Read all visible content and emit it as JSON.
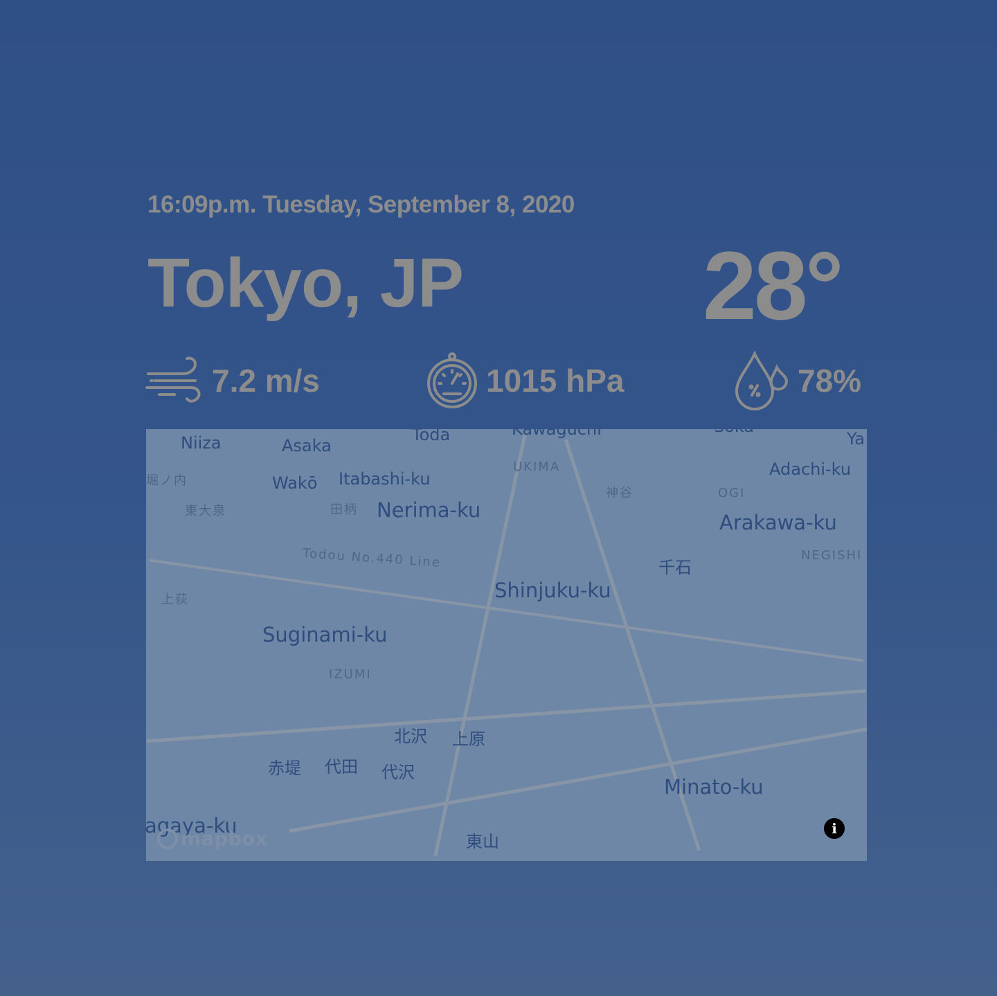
{
  "header": {
    "datetime": "16:09p.m. Tuesday, September 8, 2020",
    "city": "Tokyo, JP",
    "temperature": "28°"
  },
  "stats": {
    "wind": {
      "icon": "wind-icon",
      "value": "7.2 m/s"
    },
    "pressure": {
      "icon": "barometer-icon",
      "value": "1015 hPa"
    },
    "humidity": {
      "icon": "humidity-drops-icon",
      "value": "78%"
    }
  },
  "map": {
    "labels": [
      "Niiza",
      "Asaka",
      "Toda",
      "Kawaguchi",
      "Soka",
      "Ya",
      "Wakō",
      "Itabashi-ku",
      "UKIMA",
      "Adachi-ku",
      "Nerima-ku",
      "神谷",
      "OGI",
      "東大泉",
      "田柄",
      "Arakawa-ku",
      "Todou No.440 Line",
      "千石",
      "NEGISHI",
      "上荻",
      "Shinjuku-ku",
      "Suginami-ku",
      "IZUMI",
      "北沢",
      "上原",
      "赤堤",
      "代田",
      "代沢",
      "Minato-ku",
      "東山",
      "agaya-ku",
      "堀ノ内"
    ],
    "attribution": "mapbox",
    "info_icon": "info-icon"
  },
  "colors": {
    "background": "#2f4f87",
    "text": "#8c8c8c",
    "map_label": "#2e4d7e"
  }
}
